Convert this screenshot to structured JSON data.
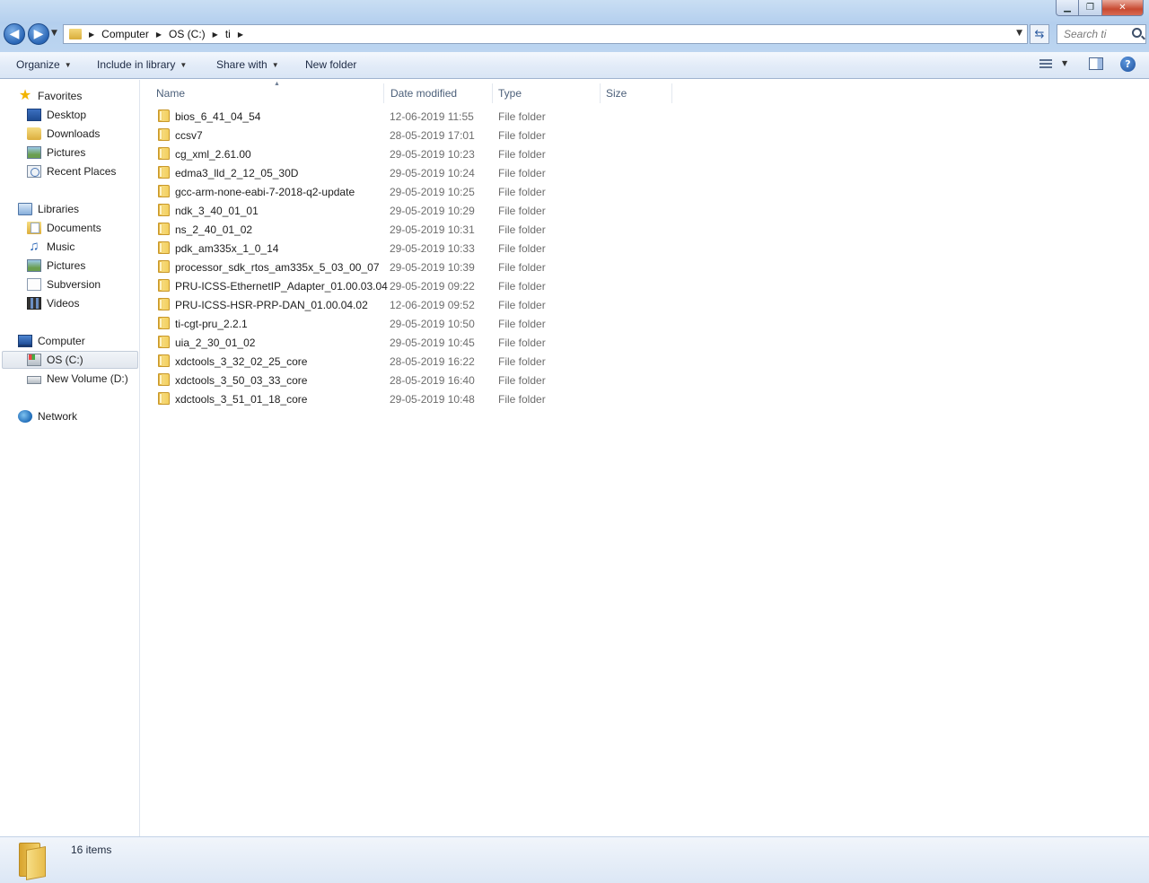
{
  "window": {
    "controls": {
      "minimize": "▁",
      "maximize": "❐",
      "close": "✕"
    }
  },
  "address": {
    "breadcrumbs": [
      "Computer",
      "OS (C:)",
      "ti"
    ]
  },
  "search": {
    "placeholder": "Search ti"
  },
  "commandbar": {
    "organize": "Organize",
    "include_in_library": "Include in library",
    "share_with": "Share with",
    "new_folder": "New folder"
  },
  "navpane": {
    "favorites": {
      "label": "Favorites",
      "items": [
        "Desktop",
        "Downloads",
        "Pictures",
        "Recent Places"
      ]
    },
    "libraries": {
      "label": "Libraries",
      "items": [
        "Documents",
        "Music",
        "Pictures",
        "Subversion",
        "Videos"
      ]
    },
    "computer": {
      "label": "Computer",
      "items": [
        "OS (C:)",
        "New Volume (D:)"
      ]
    },
    "network": {
      "label": "Network"
    }
  },
  "columns": {
    "name": "Name",
    "date_modified": "Date modified",
    "type": "Type",
    "size": "Size"
  },
  "files": [
    {
      "name": "bios_6_41_04_54",
      "date": "12-06-2019 11:55",
      "type": "File folder"
    },
    {
      "name": "ccsv7",
      "date": "28-05-2019 17:01",
      "type": "File folder"
    },
    {
      "name": "cg_xml_2.61.00",
      "date": "29-05-2019 10:23",
      "type": "File folder"
    },
    {
      "name": "edma3_lld_2_12_05_30D",
      "date": "29-05-2019 10:24",
      "type": "File folder"
    },
    {
      "name": "gcc-arm-none-eabi-7-2018-q2-update",
      "date": "29-05-2019 10:25",
      "type": "File folder"
    },
    {
      "name": "ndk_3_40_01_01",
      "date": "29-05-2019 10:29",
      "type": "File folder"
    },
    {
      "name": "ns_2_40_01_02",
      "date": "29-05-2019 10:31",
      "type": "File folder"
    },
    {
      "name": "pdk_am335x_1_0_14",
      "date": "29-05-2019 10:33",
      "type": "File folder"
    },
    {
      "name": "processor_sdk_rtos_am335x_5_03_00_07",
      "date": "29-05-2019 10:39",
      "type": "File folder"
    },
    {
      "name": "PRU-ICSS-EthernetIP_Adapter_01.00.03.04",
      "date": "29-05-2019 09:22",
      "type": "File folder"
    },
    {
      "name": "PRU-ICSS-HSR-PRP-DAN_01.00.04.02",
      "date": "12-06-2019 09:52",
      "type": "File folder"
    },
    {
      "name": "ti-cgt-pru_2.2.1",
      "date": "29-05-2019 10:50",
      "type": "File folder"
    },
    {
      "name": "uia_2_30_01_02",
      "date": "29-05-2019 10:45",
      "type": "File folder"
    },
    {
      "name": "xdctools_3_32_02_25_core",
      "date": "28-05-2019 16:22",
      "type": "File folder"
    },
    {
      "name": "xdctools_3_50_03_33_core",
      "date": "28-05-2019 16:40",
      "type": "File folder"
    },
    {
      "name": "xdctools_3_51_01_18_core",
      "date": "29-05-2019 10:48",
      "type": "File folder"
    }
  ],
  "status": {
    "item_count": "16 items"
  }
}
